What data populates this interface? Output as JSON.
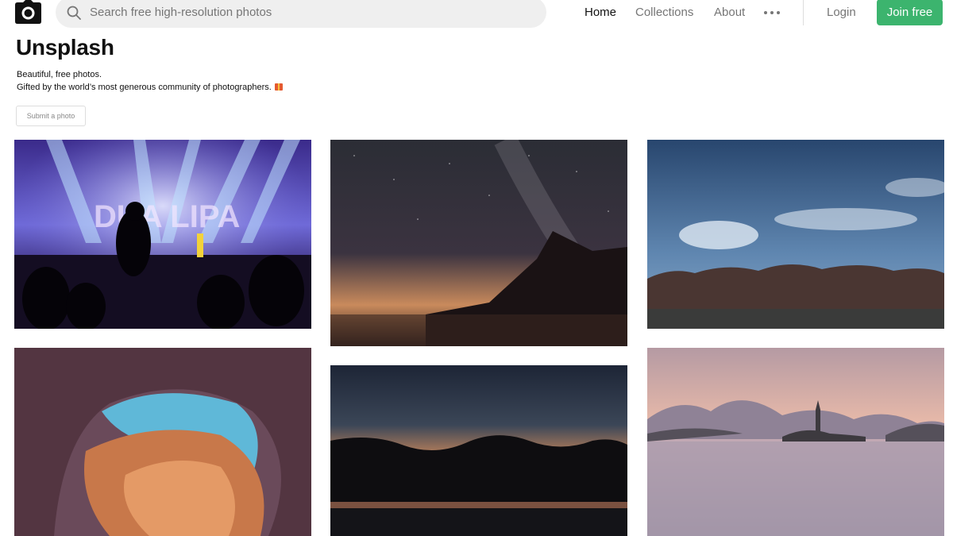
{
  "header": {
    "logo_icon": "camera-icon",
    "search": {
      "placeholder": "Search free high-resolution photos",
      "icon": "search-icon"
    },
    "nav": {
      "home": "Home",
      "collections": "Collections",
      "about": "About",
      "more_icon": "more-horizontal-icon"
    },
    "login": "Login",
    "join": "Join free"
  },
  "hero": {
    "title": "Unsplash",
    "tagline_1": "Beautiful, free photos.",
    "tagline_2": "Gifted by the world’s most generous community of photographers.",
    "gift_icon": "gift-icon",
    "submit_button": "Submit a photo"
  },
  "colors": {
    "accent_green": "#3cb46e",
    "search_bg": "#efefef",
    "muted_text": "#767676"
  }
}
